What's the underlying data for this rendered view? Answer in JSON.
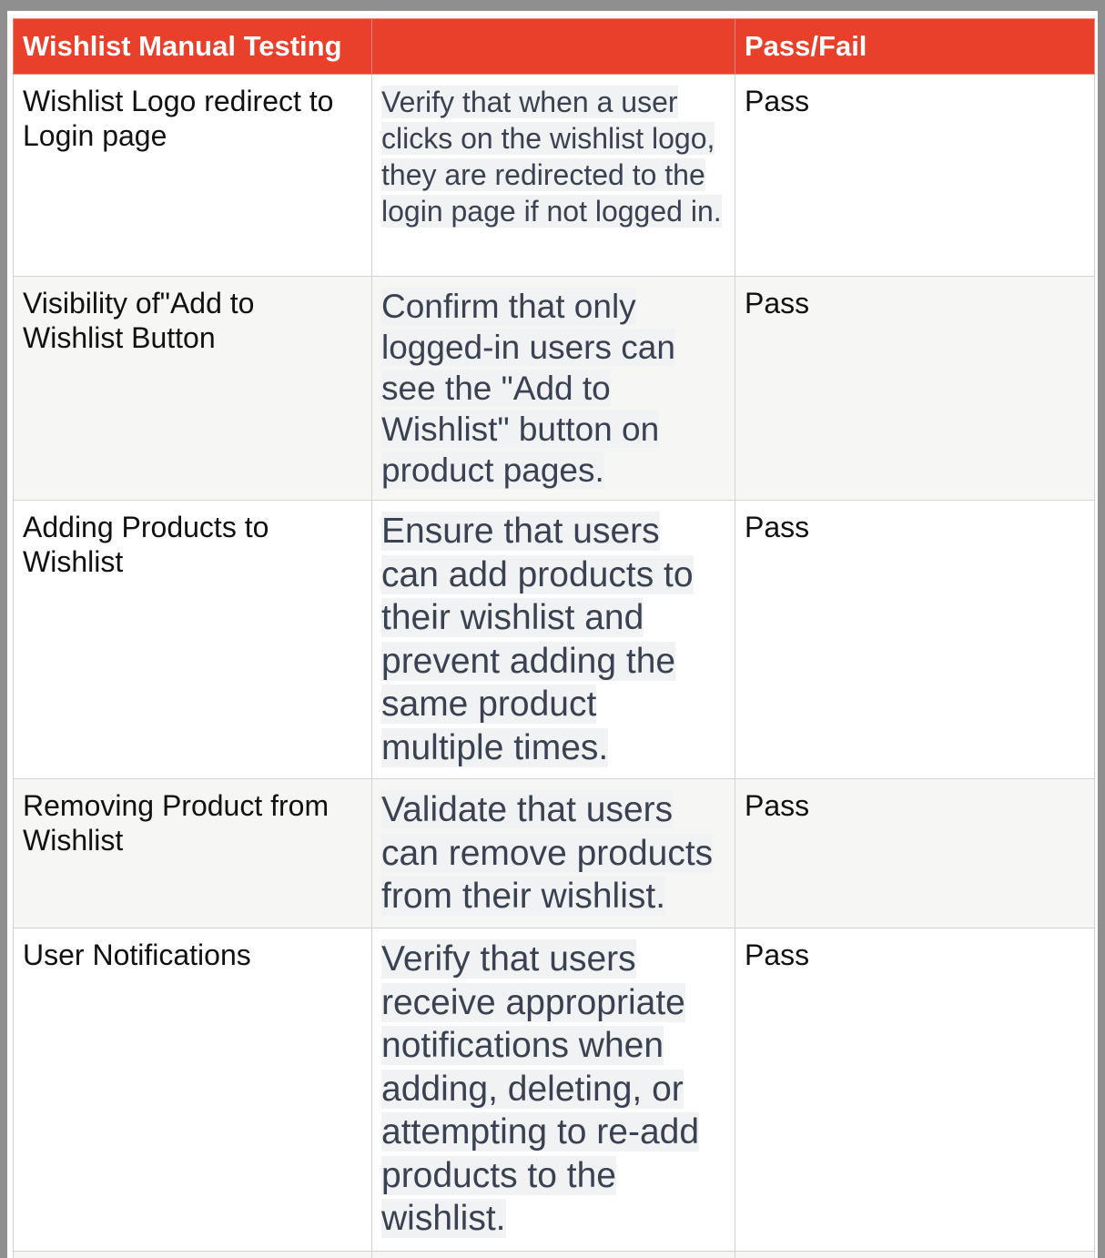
{
  "table": {
    "headers": [
      "Wishlist Manual Testing",
      "",
      "Pass/Fail"
    ],
    "rows": [
      {
        "name": "Wishlist Logo redirect to Login page",
        "description": "Verify that when a user clicks on the wishlist logo, they are redirected to the login page if not logged in.",
        "result": "Pass"
      },
      {
        "name": "Visibility of\"Add to Wishlist Button",
        "description": "Confirm that only logged-in users can see the \"Add to Wishlist\" button on product pages.",
        "result": "Pass"
      },
      {
        "name": "Adding Products to Wishlist",
        "description": "Ensure that users can add products to their wishlist and prevent adding the same product multiple times.",
        "result": "Pass"
      },
      {
        "name": "Removing Product from Wishlist",
        "description": "Validate that users can remove products from their wishlist.",
        "result": "Pass"
      },
      {
        "name": "User Notifications",
        "description": "Verify that users receive appropriate notifications when adding, deleting, or attempting to re-add products to the wishlist.",
        "result": "Pass"
      }
    ]
  },
  "colors": {
    "header_bg": "#e8402a",
    "header_text": "#ffffff",
    "frame": "#8f8f8f",
    "row_alt": "#f6f6f4"
  }
}
